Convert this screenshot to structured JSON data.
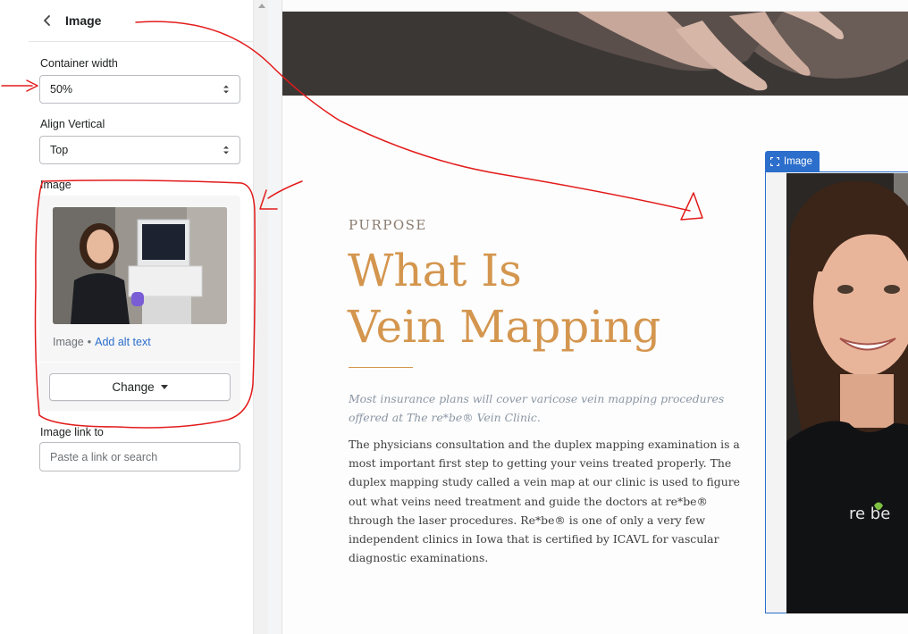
{
  "panel": {
    "back_icon": "chevron-left-icon",
    "title": "Image",
    "container_width": {
      "label": "Container width",
      "value": "50%"
    },
    "align_vertical": {
      "label": "Align Vertical",
      "value": "Top"
    },
    "image": {
      "label": "Image",
      "type_text": "Image",
      "separator": "•",
      "alt_link": "Add alt text",
      "change_label": "Change"
    },
    "image_link": {
      "label": "Image link to",
      "placeholder": "Paste a link or search"
    }
  },
  "preview": {
    "eyebrow": "PURPOSE",
    "headline_line1": "What Is",
    "headline_line2": "Vein Mapping",
    "lead": "Most insurance plans will cover varicose vein mapping procedures offered at The re*be® Vein Clinic.",
    "body": "The physicians consultation and the duplex mapping examination is a most important first step to getting your veins treated properly. The duplex mapping study called a vein map at our clinic is used to figure out what veins need treatment and guide the doctors at re*be® through the laser procedures. Re*be® is one of only a very few independent clinics in Iowa that is certified by ICAVL for vascular diagnostic examinations.",
    "image_badge": "Image",
    "shirt_logo": "re be"
  },
  "colors": {
    "accent": "#d4964f",
    "link": "#2c6ecb",
    "annotation": "#e31b1b"
  }
}
